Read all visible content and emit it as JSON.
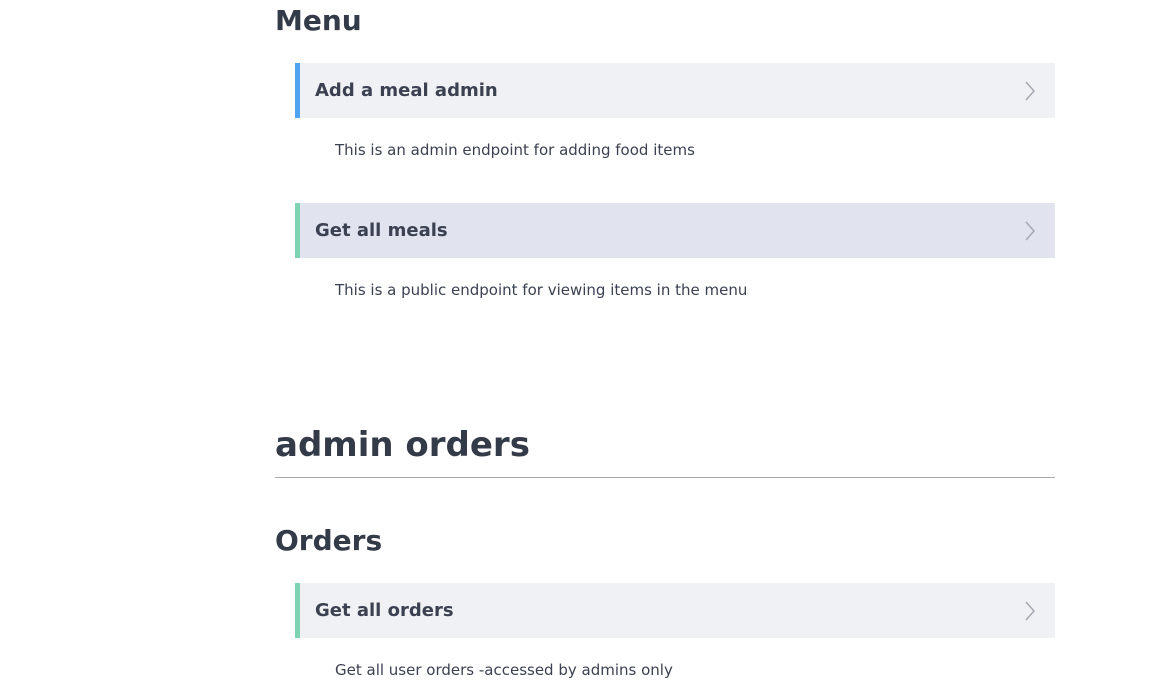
{
  "sections": {
    "menu": {
      "title": "Menu",
      "operations": [
        {
          "title": "Add a meal admin",
          "description": "This is an admin endpoint for adding food items"
        },
        {
          "title": "Get all meals",
          "description": "This is a public endpoint for viewing items in the menu"
        }
      ]
    },
    "admin_orders": {
      "group_title": "admin orders",
      "orders": {
        "title": "Orders",
        "operations": [
          {
            "title": "Get all orders",
            "description": "Get all user orders -accessed by admins only"
          }
        ]
      }
    }
  },
  "colors": {
    "post_accent": "#4fa3f0",
    "get_accent": "#7ed3b2",
    "header_bg": "#f0f1f4",
    "header_bg_active": "#e1e3ee"
  },
  "icons": {
    "expand": "chevron-right-icon"
  }
}
